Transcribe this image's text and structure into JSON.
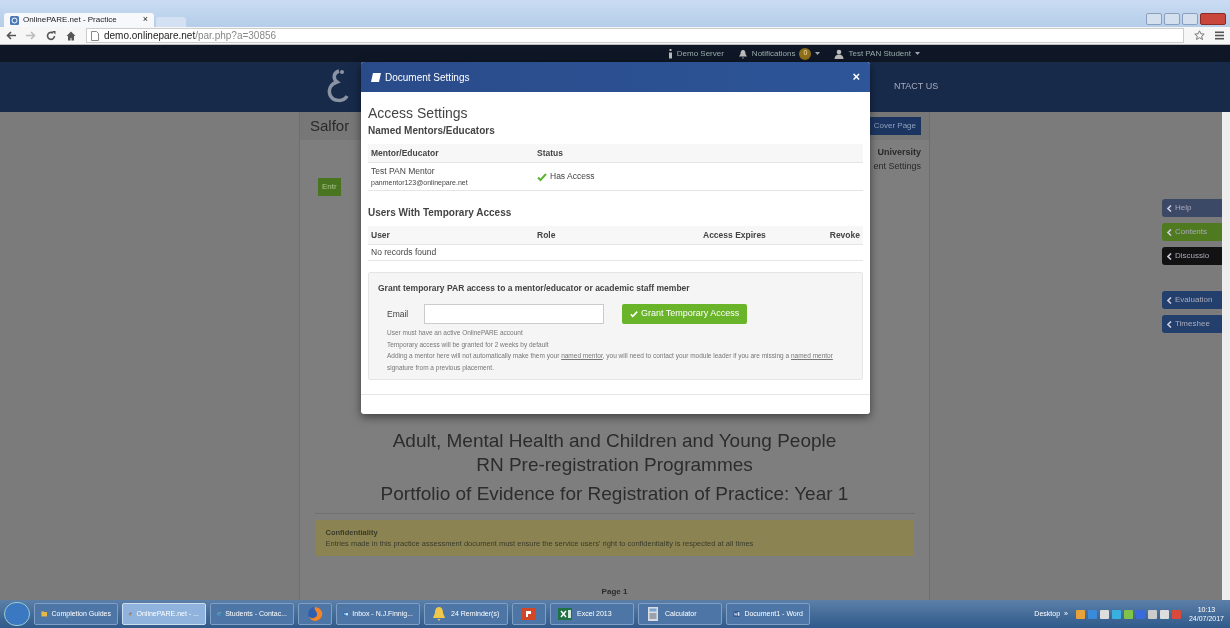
{
  "browser": {
    "tab_title": "OnlinePARE.net - Practice",
    "tab_close": "×",
    "url_host": "demo.onlinepare.net",
    "url_path": "/par.php?a=30856"
  },
  "top_nav": [
    {
      "kind": "info",
      "label": "Demo Server"
    },
    {
      "kind": "bell",
      "label": "Notifications",
      "badge": "0"
    },
    {
      "kind": "user",
      "label": "Test PAN Student"
    }
  ],
  "header": {
    "menu_item": "NTACT US"
  },
  "page": {
    "title": "Salfor",
    "cover_button": "Cover Page",
    "university": "University",
    "settings_link": "ent Settings",
    "entry_button": "Entr",
    "headings": [
      "Adult, Mental Health and Children and Young People",
      "RN Pre-registration Programmes"
    ],
    "portfolio_title": "Portfolio of Evidence for Registration of Practice: Year 1",
    "notice": {
      "title": "Confidentiality",
      "text": "Entries made in this practice assessment document must ensure the service users' right to confidentiality is respected at all times"
    },
    "page_label": "Page 1"
  },
  "side_tabs": [
    {
      "label": "Help",
      "color": "#3b4866"
    },
    {
      "label": "Contents",
      "color": "#4f7a1f"
    },
    {
      "label": "Discussio",
      "color": "#121212"
    },
    {
      "label": "Evaluation",
      "color": "#233f6b"
    },
    {
      "label": "Timeshee",
      "color": "#233f6b"
    }
  ],
  "modal": {
    "title": "Document Settings",
    "close": "×",
    "heading": "Access Settings",
    "mentors": {
      "title": "Named Mentors/Educators",
      "columns": [
        "Mentor/Educator",
        "Status"
      ],
      "rows": [
        {
          "name": "Test PAN Mentor",
          "email": "panmentor123@onlinepare.net",
          "status": "Has Access",
          "has_access": true
        }
      ]
    },
    "temporary": {
      "title": "Users With Temporary Access",
      "columns": [
        "User",
        "Role",
        "Access Expires",
        "Revoke"
      ],
      "empty": "No records found"
    },
    "grant": {
      "title": "Grant temporary PAR access to a mentor/educator or academic staff member",
      "email_label": "Email",
      "button": "Grant Temporary Access",
      "notes": [
        "User must have an active OnlinePARE account",
        "Temporary access will be granted for 2 weeks by default"
      ],
      "warning": [
        "Adding a mentor here will not automatically make them your ",
        "named mentor",
        ", you will need to contact your module leader if you are missing a ",
        "named mentor",
        " signature from a previous placement."
      ]
    }
  },
  "taskbar": {
    "items": [
      {
        "kind": "folder",
        "label": "Completion Guides",
        "selected": false
      },
      {
        "kind": "chrome",
        "label": "OnlinePARE.net - ...",
        "selected": true
      },
      {
        "kind": "ie",
        "label": "Students - Contac...",
        "selected": false
      },
      {
        "kind": "firefox",
        "selected": false
      },
      {
        "kind": "outlook",
        "label": "Inbox - N.J.Finnig...",
        "selected": false
      },
      {
        "kind": "bell",
        "label": "24 Reminder(s)",
        "selected": false
      },
      {
        "kind": "powerpoint",
        "selected": false
      },
      {
        "kind": "excel",
        "label": "Excel 2013",
        "selected": false
      },
      {
        "kind": "calculator",
        "label": "Calculator",
        "selected": false
      },
      {
        "kind": "word",
        "label": "Document1 - Word",
        "selected": false
      }
    ],
    "desktop": "Desktop",
    "chevron": "»",
    "time": "10:13",
    "date": "24/07/2017"
  }
}
